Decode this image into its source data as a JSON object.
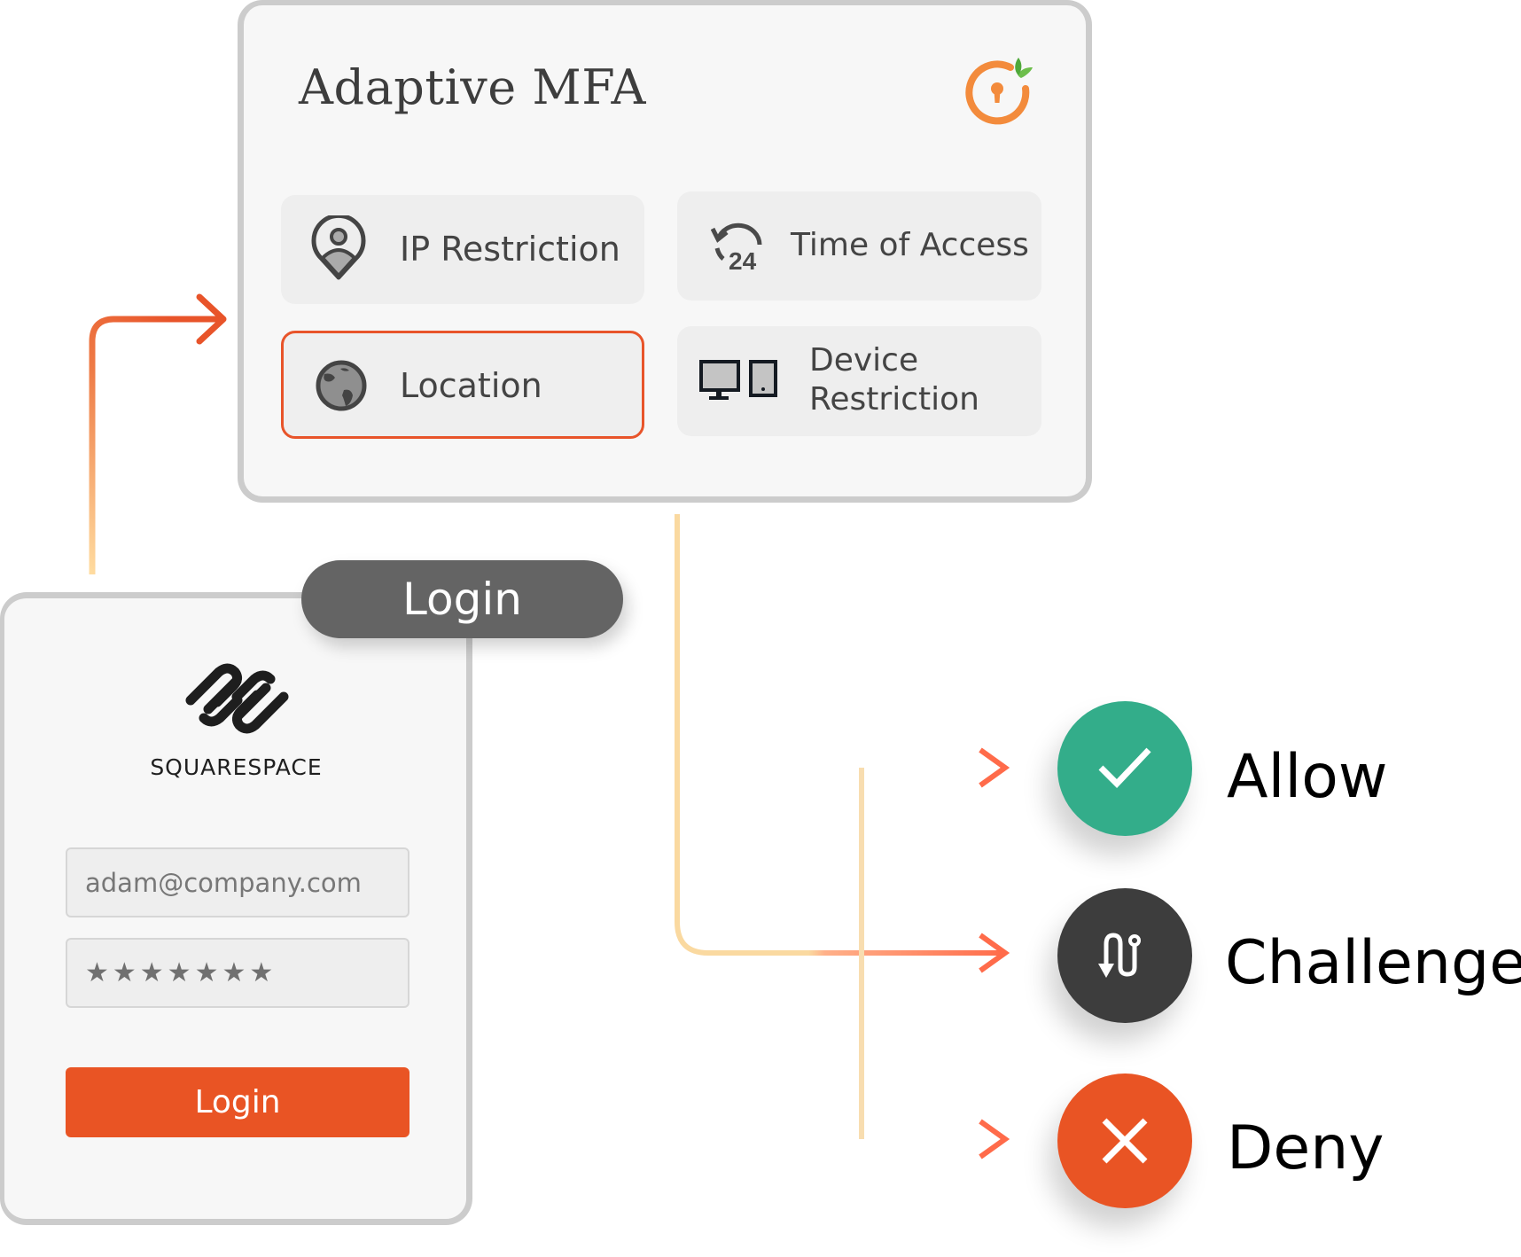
{
  "mfa_panel": {
    "title": "Adaptive MFA",
    "brand_icon": "orange-keyhole-ring-with-leaf",
    "factors": [
      {
        "label": "IP Restriction",
        "icon": "location-pin-user-icon",
        "selected": false
      },
      {
        "label": "Time of Access",
        "icon": "clock-24h-icon",
        "selected": false
      },
      {
        "label": "Location",
        "icon": "globe-icon",
        "selected": true
      },
      {
        "label_line1": "Device",
        "label_line2": "Restriction",
        "icon": "desktop-tablet-icon",
        "selected": false
      }
    ]
  },
  "login_card": {
    "tab_label": "Login",
    "brand_name": "SQUARESPACE",
    "email_value": "adam@company.com",
    "password_mask": "★★★★★★★",
    "submit_label": "Login"
  },
  "outcomes": [
    {
      "label": "Allow",
      "icon": "checkmark-icon",
      "color": "#33AD8A"
    },
    {
      "label": "Challenge",
      "icon": "winding-path-arrow-icon",
      "color": "#3D3D3D"
    },
    {
      "label": "Deny",
      "icon": "x-icon",
      "color": "#E95424"
    }
  ],
  "colors": {
    "accent": "#E8542A",
    "connector_light": "#FAD9A0",
    "connector_dark": "#FF6B4A",
    "card_border": "#CCCCCC"
  }
}
